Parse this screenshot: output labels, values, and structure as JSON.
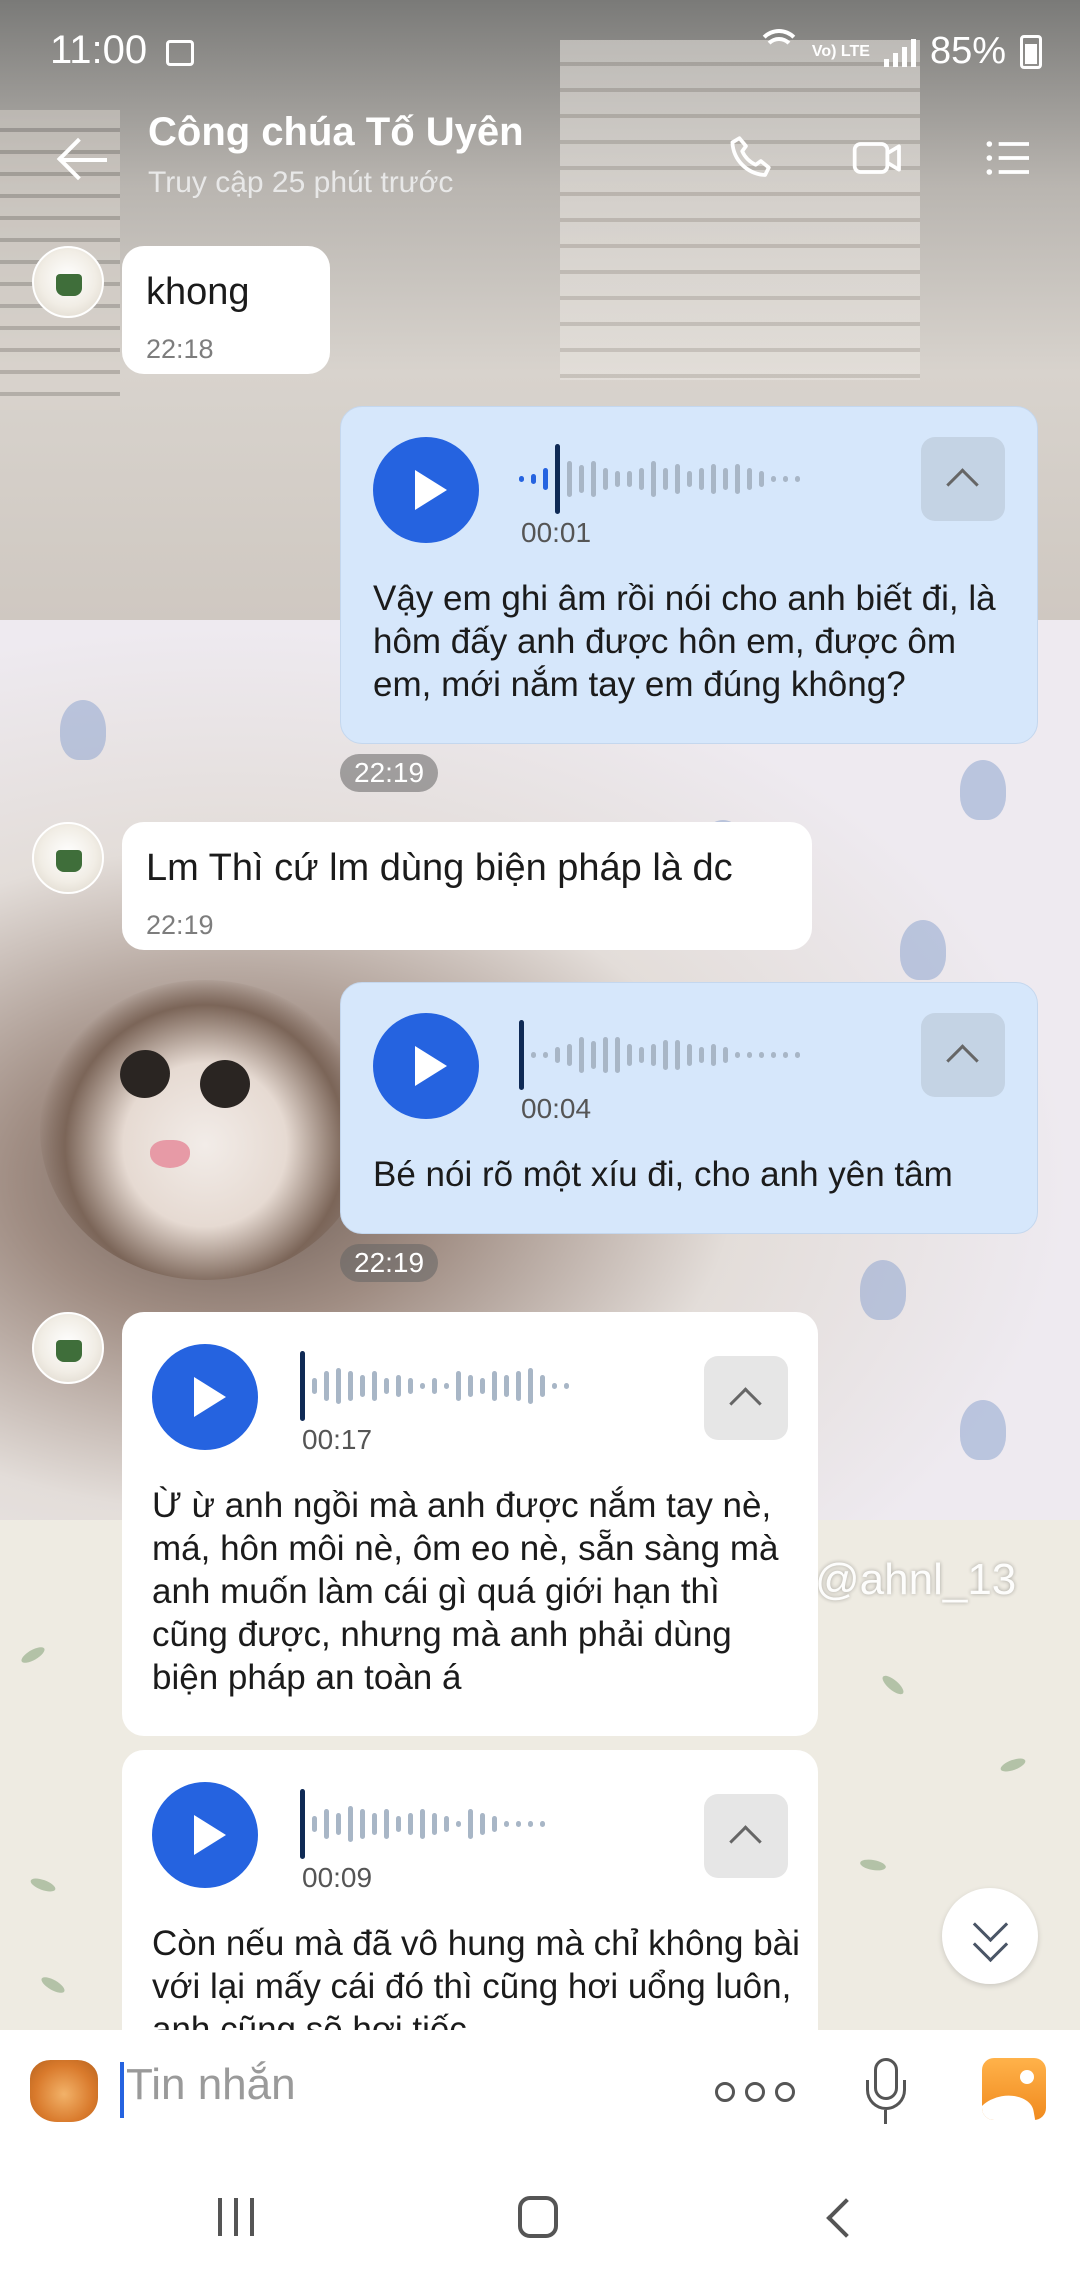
{
  "status_bar": {
    "time": "11:00",
    "battery": "85%",
    "network": "Vo) LTE"
  },
  "header": {
    "title": "Công chúa Tố Uyên",
    "subtitle": "Truy cập 25 phút trước"
  },
  "messages": [
    {
      "text": "khong",
      "time": "22:18"
    },
    {
      "duration": "00:01",
      "transcript": "Vậy em ghi âm rồi nói cho anh biết đi, là hôm đấy anh được hôn em, được ôm em, mới nắm tay em đúng không?"
    },
    {
      "separator_time": "22:19"
    },
    {
      "text": "Lm Thì cứ lm dùng biện pháp là dc",
      "time": "22:19"
    },
    {
      "duration": "00:04",
      "transcript": "Bé nói rõ một xíu đi, cho anh yên tâm"
    },
    {
      "separator_time": "22:19"
    },
    {
      "duration": "00:17",
      "transcript": "Ừ ừ anh ngồi mà anh được nắm tay nè, má, hôn môi nè, ôm eo nè, sẵn sàng mà anh muốn làm cái gì quá giới hạn thì cũng được, nhưng mà anh phải dùng biện pháp an toàn á"
    },
    {
      "duration": "00:09",
      "transcript": "Còn nếu mà đã vô hung mà chỉ không bài với lại mấy cái đó thì cũng hơi uổng luôn, anh cũng sẽ hơi tiếc"
    }
  ],
  "watermark": "@ahnl_13",
  "input": {
    "placeholder": "Tin nhắn"
  },
  "colors": {
    "accent": "#2563e0",
    "sent_bubble": "#d6e7fb",
    "received_bubble": "#ffffff"
  },
  "icons": [
    "back-arrow-icon",
    "phone-icon",
    "video-icon",
    "menu-list-icon",
    "play-icon",
    "chevron-up-icon",
    "chevron-double-down-icon",
    "sticker-icon",
    "more-icon",
    "mic-icon",
    "gallery-icon"
  ]
}
